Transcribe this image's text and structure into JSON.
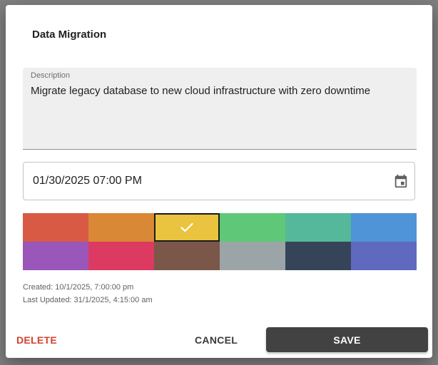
{
  "dialog": {
    "title": "Data Migration"
  },
  "description": {
    "label": "Description",
    "value": "Migrate legacy database to new cloud infrastructure with zero downtime"
  },
  "datetime": {
    "value": "01/30/2025 07:00 PM",
    "icon": "calendar-icon"
  },
  "colors": {
    "selected_index": 2,
    "swatches": [
      {
        "name": "red",
        "hex": "#d95a44"
      },
      {
        "name": "orange",
        "hex": "#d98836"
      },
      {
        "name": "yellow",
        "hex": "#eac43f"
      },
      {
        "name": "green",
        "hex": "#5fc878"
      },
      {
        "name": "teal",
        "hex": "#55b89a"
      },
      {
        "name": "blue",
        "hex": "#4e94d6"
      },
      {
        "name": "purple",
        "hex": "#9a56b8"
      },
      {
        "name": "pink",
        "hex": "#dd3a62"
      },
      {
        "name": "brown",
        "hex": "#7a5749"
      },
      {
        "name": "gray",
        "hex": "#9ba5a7"
      },
      {
        "name": "navy",
        "hex": "#364459"
      },
      {
        "name": "indigo",
        "hex": "#5f6abf"
      }
    ],
    "check_icon": "check-icon"
  },
  "meta": {
    "created": "Created: 10/1/2025, 7:00:00 pm",
    "updated": "Last Updated: 31/1/2025, 4:15:00 am"
  },
  "actions": {
    "delete_label": "DELETE",
    "cancel_label": "CANCEL",
    "save_label": "SAVE",
    "delete_color": "#d0422f",
    "save_bg": "#424242"
  }
}
